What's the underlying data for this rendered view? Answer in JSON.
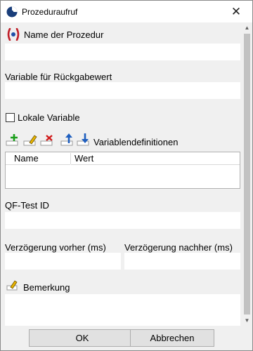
{
  "window": {
    "title": "Prozeduraufruf"
  },
  "fields": {
    "procedure_name_label": "Name der Prozedur",
    "procedure_name_value": "",
    "return_variable_label": "Variable für Rückgabewert",
    "return_variable_value": "",
    "local_variable_label": "Lokale Variable",
    "local_variable_checked": false,
    "variables_label": "Variablendefinitionen",
    "qftest_id_label": "QF-Test ID",
    "qftest_id_value": "",
    "delay_before_label": "Verzögerung vorher (ms)",
    "delay_before_value": "",
    "delay_after_label": "Verzögerung nachher (ms)",
    "delay_after_value": "",
    "comment_label": "Bemerkung",
    "comment_value": ""
  },
  "variables_table": {
    "columns": [
      "Name",
      "Wert"
    ],
    "rows": []
  },
  "toolbar": {
    "icons": [
      "add-icon",
      "edit-icon",
      "delete-icon",
      "move-up-icon",
      "move-down-icon"
    ]
  },
  "buttons": {
    "ok": "OK",
    "cancel": "Abbrechen"
  },
  "colors": {
    "accent_blue": "#1f5fbf",
    "procedure_red": "#c0202a",
    "add_green": "#1a9e1a"
  }
}
